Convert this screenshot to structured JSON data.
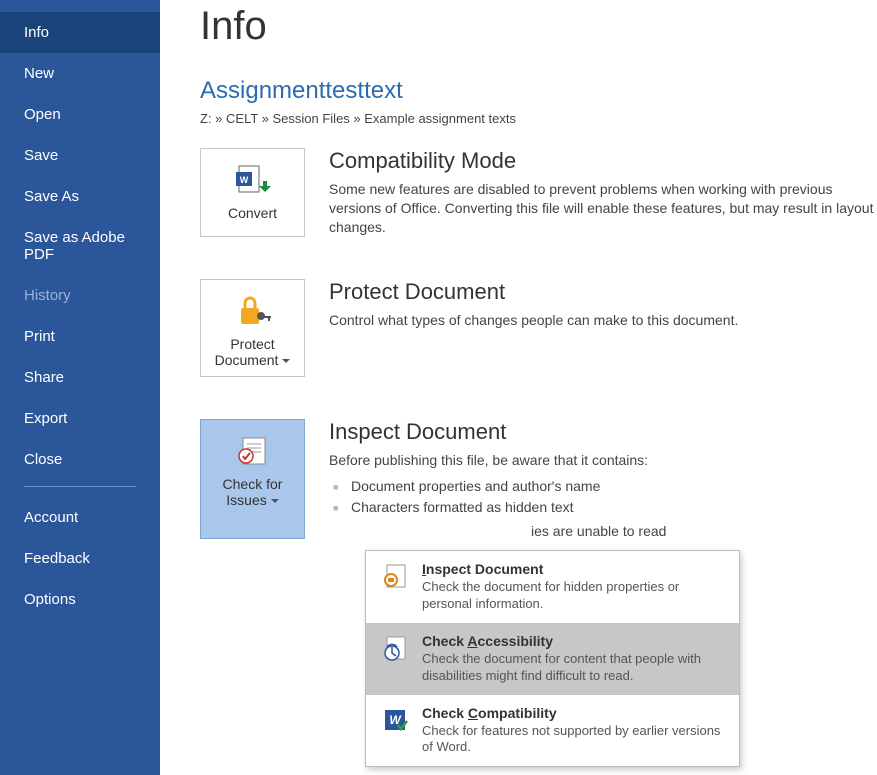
{
  "sidebar": {
    "items": [
      {
        "label": "Info",
        "state": "active"
      },
      {
        "label": "New"
      },
      {
        "label": "Open"
      },
      {
        "label": "Save"
      },
      {
        "label": "Save As"
      },
      {
        "label": "Save as Adobe PDF"
      },
      {
        "label": "History",
        "state": "disabled"
      },
      {
        "label": "Print"
      },
      {
        "label": "Share"
      },
      {
        "label": "Export"
      },
      {
        "label": "Close"
      }
    ],
    "lower": [
      {
        "label": "Account"
      },
      {
        "label": "Feedback"
      },
      {
        "label": "Options"
      }
    ]
  },
  "page_title": "Info",
  "doc_title": "Assignmenttesttext",
  "breadcrumb": "Z: » CELT » Session Files » Example assignment texts",
  "compatibility": {
    "button": "Convert",
    "heading": "Compatibility Mode",
    "text": "Some new features are disabled to prevent problems when working with previous versions of Office. Converting this file will enable these features, but may result in layout changes."
  },
  "protect": {
    "button": "Protect Document",
    "heading": "Protect Document",
    "text": "Control what types of changes people can make to this document."
  },
  "inspect": {
    "button": "Check for Issues",
    "heading": "Inspect Document",
    "intro": "Before publishing this file, be aware that it contains:",
    "bullets": [
      "Document properties and author's name",
      "Characters formatted as hidden text"
    ],
    "truncated_line": "ies are unable to read"
  },
  "dropdown": {
    "items": [
      {
        "title": "Inspect Document",
        "underline": 0,
        "desc": "Check the document for hidden properties or personal information."
      },
      {
        "title": "Check Accessibility",
        "underline": 6,
        "desc": "Check the document for content that people with disabilities might find difficult to read.",
        "hover": true
      },
      {
        "title": "Check Compatibility",
        "underline": 6,
        "desc": "Check for features not supported by earlier versions of Word."
      }
    ]
  }
}
